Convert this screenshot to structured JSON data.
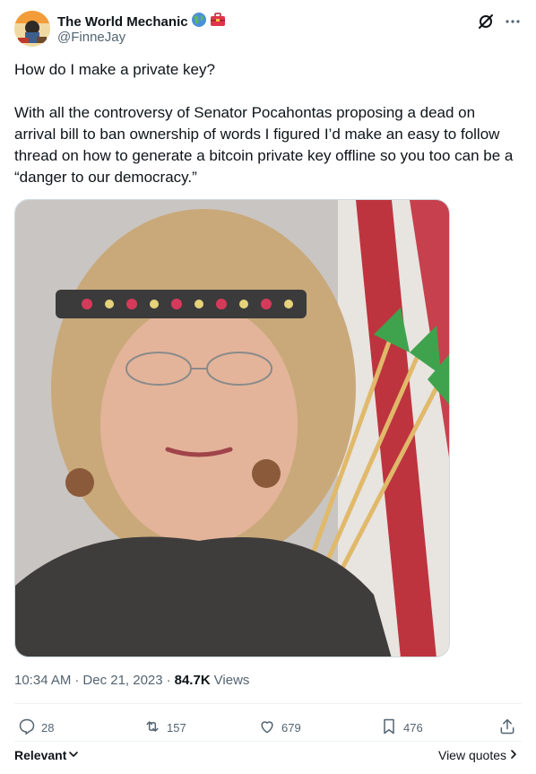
{
  "author": {
    "display_name": "The World Mechanic",
    "handle": "@FinneJay",
    "badges": [
      "globe-americas-emoji",
      "toolbox-emoji"
    ]
  },
  "tweet": {
    "text": "How do I make a private key?\n\nWith all the controversy of Senator Pocahontas proposing a dead on arrival bill to ban ownership of words I figured I’d make an easy to follow thread on how to generate a bitcoin private key offline so you too can be a “danger to our democracy.”",
    "time": "10:34 AM",
    "date": "Dec 21, 2023",
    "views_count": "84.7K",
    "views_label": "Views"
  },
  "actions": {
    "replies": "28",
    "reposts": "157",
    "likes": "679",
    "bookmarks": "476"
  },
  "footer": {
    "sort_label": "Relevant",
    "view_quotes_label": "View quotes"
  },
  "icons": {
    "grok": "grok-icon",
    "more": "more-icon",
    "reply": "reply-icon",
    "repost": "repost-icon",
    "like": "like-icon",
    "bookmark": "bookmark-icon",
    "share": "share-icon"
  },
  "colors": {
    "text_primary": "#0f1419",
    "text_secondary": "#536471",
    "border": "#cfd9de",
    "divider": "#eff3f4"
  }
}
